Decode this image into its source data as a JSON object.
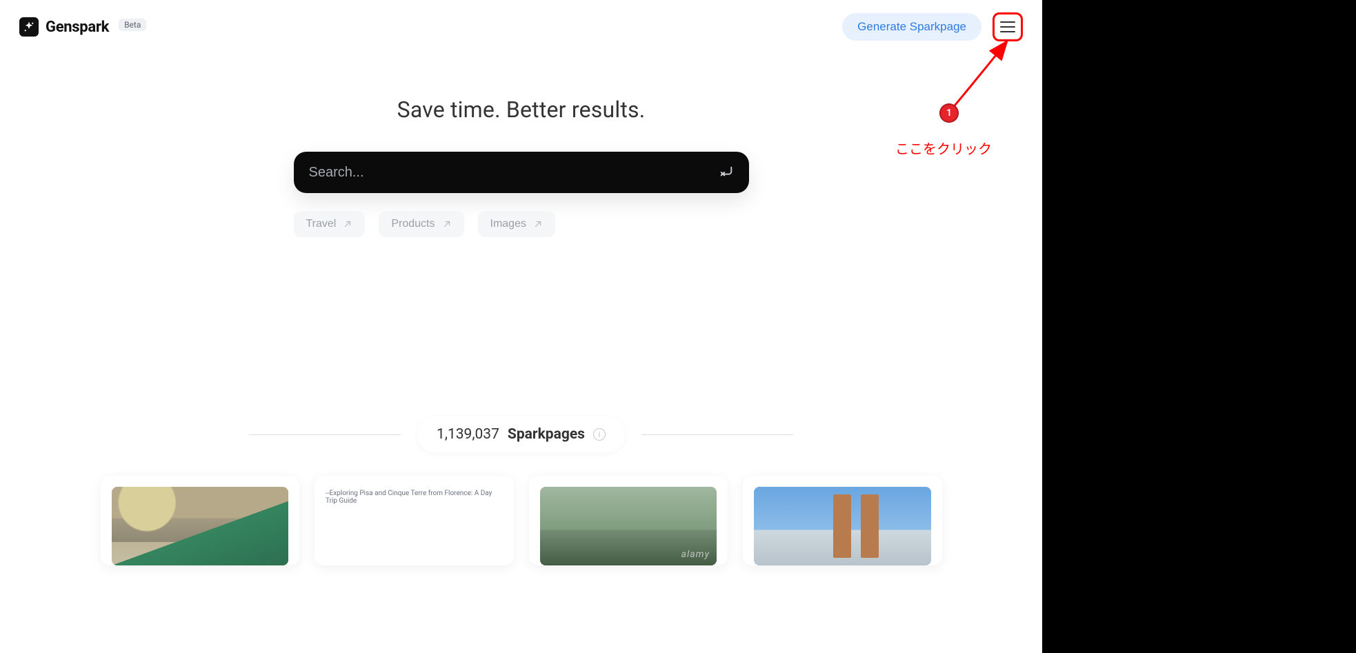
{
  "header": {
    "brand": "Genspark",
    "badge": "Beta",
    "generate_label": "Generate Sparkpage"
  },
  "annotation": {
    "badge": "1",
    "text": "ここをクリック"
  },
  "hero": {
    "title": "Save time. Better results.",
    "search_placeholder": "Search..."
  },
  "chips": [
    {
      "label": "Travel"
    },
    {
      "label": "Products"
    },
    {
      "label": "Images"
    }
  ],
  "sparkpages": {
    "count": "1,139,037",
    "label": "Sparkpages"
  },
  "cards": [
    {
      "type": "image"
    },
    {
      "type": "text",
      "title": "--Exploring Pisa and Cinque Terre from Florence: A Day Trip Guide"
    },
    {
      "type": "image",
      "watermark": "alamy"
    },
    {
      "type": "image"
    }
  ]
}
